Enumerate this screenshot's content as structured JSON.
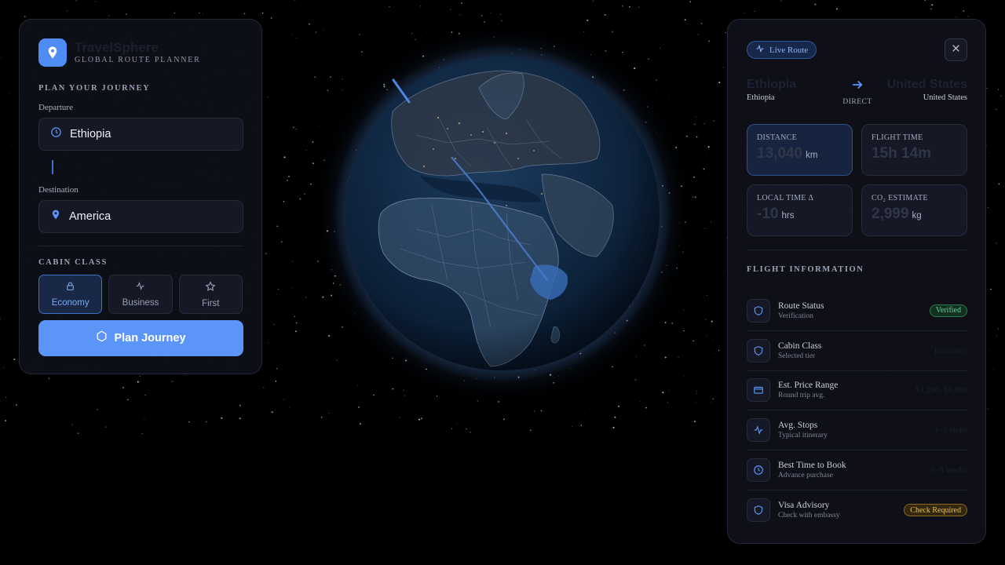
{
  "brand": {
    "title": "TravelSphere",
    "subtitle": "GLOBAL ROUTE PLANNER",
    "icon": "map-pin-icon"
  },
  "planner": {
    "section_label": "PLAN YOUR JOURNEY",
    "departure_label": "Departure",
    "departure_value": "Ethiopia",
    "destination_label": "Destination",
    "destination_value": "America",
    "cabin_label": "CABIN CLASS",
    "cabin_options": [
      {
        "label": "Economy",
        "icon": "lock-icon",
        "selected": true
      },
      {
        "label": "Business",
        "icon": "activity-icon",
        "selected": false
      },
      {
        "label": "First",
        "icon": "star-icon",
        "selected": false
      }
    ],
    "plan_button": "Plan Journey"
  },
  "route": {
    "badge": "Live Route",
    "from_title": "Ethiopia",
    "from_sub": "Ethiopia",
    "to_title": "United States",
    "to_sub": "United States",
    "mode": "DIRECT"
  },
  "stats": [
    {
      "label": "DISTANCE",
      "value": "13,040",
      "unit": "km"
    },
    {
      "label": "FLIGHT TIME",
      "value": "15h 14m",
      "unit": ""
    },
    {
      "label": "LOCAL TIME Δ",
      "value": "-10",
      "unit": "hrs"
    },
    {
      "label": "CO₂ ESTIMATE",
      "value": "2,999",
      "unit": "kg"
    }
  ],
  "flight_info": {
    "title": "FLIGHT INFORMATION",
    "rows": [
      {
        "title": "Route Status",
        "sub": "Verification",
        "value": "Verified",
        "kind": "pill-green",
        "icon": "shield-icon"
      },
      {
        "title": "Cabin Class",
        "sub": "Selected tier",
        "value": "Economy",
        "kind": "text",
        "icon": "shield-icon"
      },
      {
        "title": "Est. Price Range",
        "sub": "Round trip avg.",
        "value": "$1,200–$1,800",
        "kind": "text",
        "icon": "credit-card-icon"
      },
      {
        "title": "Avg. Stops",
        "sub": "Typical itinerary",
        "value": "1–2 stops",
        "kind": "text",
        "icon": "activity-icon"
      },
      {
        "title": "Best Time to Book",
        "sub": "Advance purchase",
        "value": "6–8 weeks",
        "kind": "text",
        "icon": "clock-icon"
      },
      {
        "title": "Visa Advisory",
        "sub": "Check with embassy",
        "value": "Check Required",
        "kind": "pill-yellow",
        "icon": "shield-icon"
      }
    ]
  },
  "colors": {
    "accent": "#5b95f7",
    "panel_bg": "#0e1018",
    "verified": "#5fd494",
    "warning": "#e8be55"
  }
}
